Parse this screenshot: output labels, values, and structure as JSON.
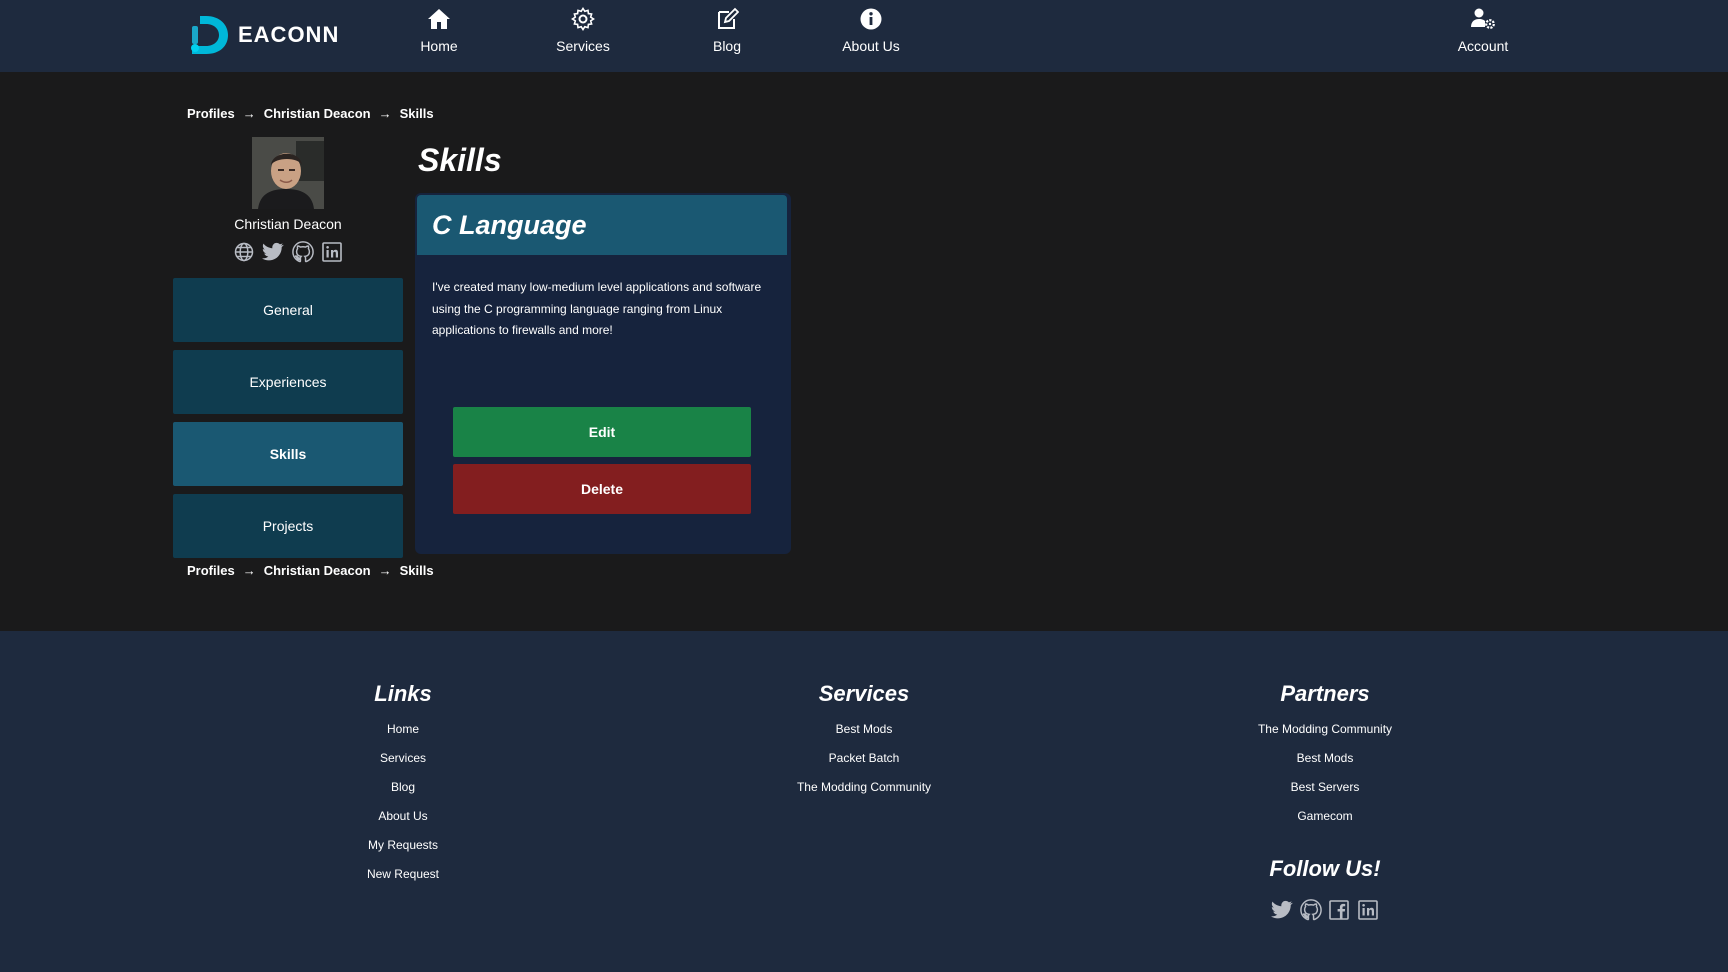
{
  "brand": {
    "name": "EACONN",
    "colors": {
      "accent": "#00b8d9",
      "header_bg": "#1e2a3e",
      "page_bg": "#1a1a1b",
      "card_bg": "#16233d",
      "teal": "#1a5872",
      "dark_teal": "#0f3c4f",
      "edit_green": "#198347",
      "delete_red": "#831e1f"
    }
  },
  "nav": {
    "items": [
      {
        "label": "Home",
        "icon": "home-icon"
      },
      {
        "label": "Services",
        "icon": "gear-icon"
      },
      {
        "label": "Blog",
        "icon": "edit-note-icon"
      },
      {
        "label": "About Us",
        "icon": "info-icon"
      }
    ],
    "account": {
      "label": "Account",
      "icon": "user-gear-icon"
    }
  },
  "breadcrumb": {
    "items": [
      "Profiles",
      "Christian Deacon",
      "Skills"
    ],
    "separator": "→"
  },
  "profile": {
    "name": "Christian Deacon",
    "socials": [
      "globe-icon",
      "twitter-icon",
      "github-icon",
      "linkedin-icon"
    ]
  },
  "sidebar": {
    "items": [
      {
        "label": "General",
        "active": false
      },
      {
        "label": "Experiences",
        "active": false
      },
      {
        "label": "Skills",
        "active": true
      },
      {
        "label": "Projects",
        "active": false
      }
    ]
  },
  "main": {
    "title": "Skills",
    "skill": {
      "name": "C Language",
      "description": "I've created many low-medium level applications and software using the C programming language ranging from Linux applications to firewalls and more!",
      "edit_label": "Edit",
      "delete_label": "Delete"
    }
  },
  "footer": {
    "links": {
      "heading": "Links",
      "items": [
        "Home",
        "Services",
        "Blog",
        "About Us",
        "My Requests",
        "New Request"
      ]
    },
    "services": {
      "heading": "Services",
      "items": [
        "Best Mods",
        "Packet Batch",
        "The Modding Community"
      ]
    },
    "partners": {
      "heading": "Partners",
      "items": [
        "The Modding Community",
        "Best Mods",
        "Best Servers",
        "Gamecom"
      ]
    },
    "follow": {
      "heading": "Follow Us!",
      "icons": [
        "twitter-icon",
        "github-icon",
        "facebook-icon",
        "linkedin-icon"
      ]
    }
  }
}
